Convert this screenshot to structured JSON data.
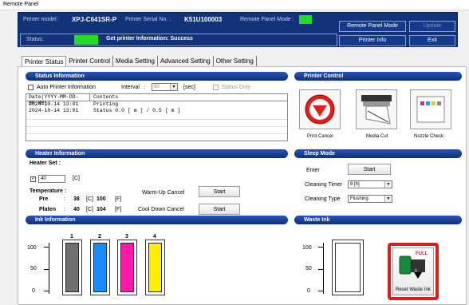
{
  "window": {
    "title": "Remote Panel"
  },
  "info": {
    "printer_model_label": "Printer model :",
    "printer_model": "XPJ-C641SR-P",
    "serial_label": "Printer Serial No. :",
    "serial": "K51U100003",
    "panel_mode_label": "Remote Panel Mode :",
    "panel_mode_color": "#22dd22",
    "status_label": "Status:",
    "status_color": "#22dd22",
    "status_message": "Get printer Information: Success",
    "btn_panel_mode": "Remote Panel Mode",
    "btn_update": "Update",
    "btn_printer_info": "Printer Info",
    "btn_exit": "Exit"
  },
  "tabs": [
    "Printer Status",
    "Printer Control",
    "Media Setting",
    "Advanced Setting",
    "Other Setting"
  ],
  "status_info": {
    "header": "Status Information",
    "auto_label": "Auto Printer Information",
    "interval_label": "Interval",
    "interval_sep": ":",
    "interval_value": "60",
    "interval_unit": "[sec]",
    "status_only": "Status Only",
    "col_date": "Date(YYYY-MM-DD-HH:MM)",
    "col_contents": "Contents",
    "rows": [
      {
        "date": "2024-10-14 13:01",
        "content": "Printing"
      },
      {
        "date": "2024-10-14 13:01",
        "content": "Status 0.0 [ m ] / 0.5 [ m ]"
      }
    ]
  },
  "printer_control": {
    "header": "Printer Control",
    "print_cancel": "Print Cancel",
    "media_cut": "Media Cut",
    "nozzle_check": "Nozzle Check"
  },
  "heater": {
    "header": "Heater Information",
    "set_label": "Heater Set :",
    "set_value": "40",
    "set_unit": "[C]",
    "temp_label": "Temperature :",
    "pre_label": "Pre",
    "pre_c": "38",
    "pre_f": "100",
    "platen_label": "Platen",
    "platen_c": "40",
    "platen_f": "104",
    "sep": ":",
    "c_unit": "[C]",
    "f_unit": "[F]",
    "warmup_label": "Warm-Up Cancel",
    "cooldown_label": "Cool Down Cancel",
    "start": "Start"
  },
  "sleep": {
    "header": "Sleep Mode",
    "enter_label": "Enter",
    "start": "Start",
    "cleaning_timer_label": "Cleaning Timer",
    "cleaning_timer_value": "8 [h]",
    "cleaning_type_label": "Cleaning Type",
    "cleaning_type_value": "Flushing"
  },
  "ink": {
    "header": "Ink Information",
    "ticks": [
      "100",
      "50",
      "0"
    ],
    "bars": [
      {
        "label": "1",
        "color": "#707070",
        "level": 100
      },
      {
        "label": "2",
        "color": "#1a8cff",
        "level": 100
      },
      {
        "label": "3",
        "color": "#ff1aa8",
        "level": 100
      },
      {
        "label": "4",
        "color": "#ffee00",
        "level": 100
      }
    ]
  },
  "waste": {
    "header": "Waste Ink",
    "ticks": [
      "100",
      "50",
      "0"
    ],
    "level": 0,
    "full_label": "FULL",
    "reset_label": "Reset Waste Ink",
    "highlight_color": "#d81e1e"
  }
}
